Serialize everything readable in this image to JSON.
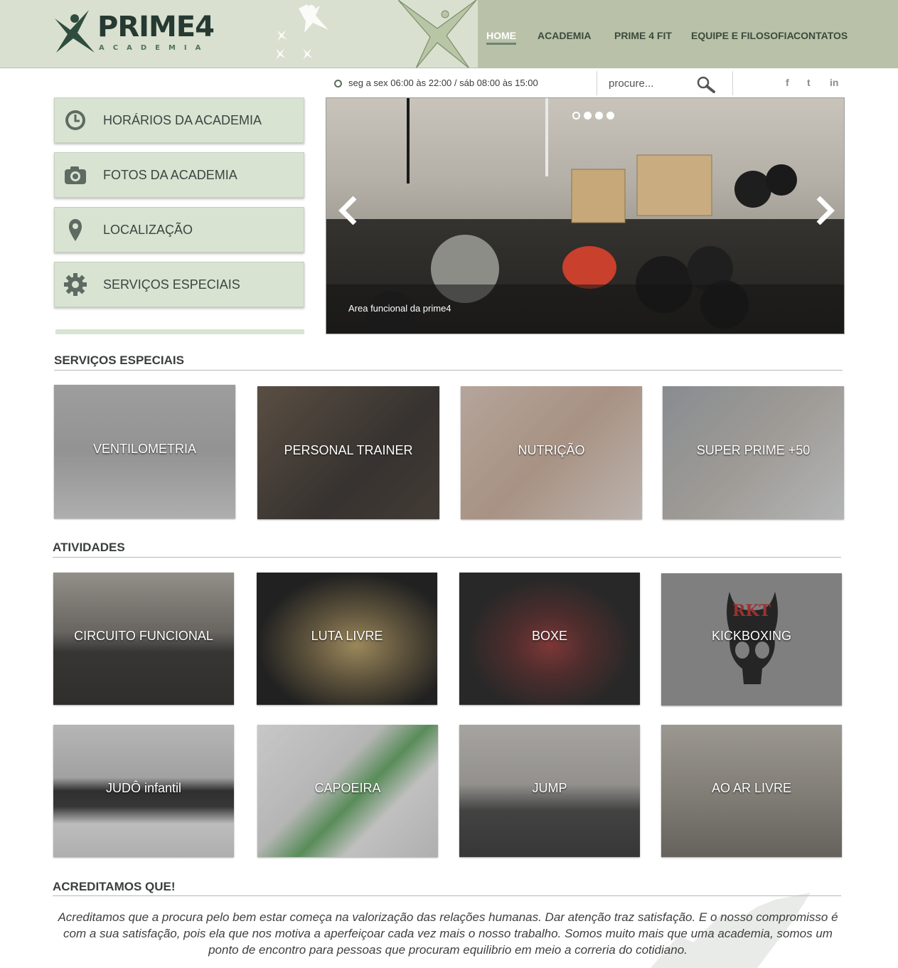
{
  "brand": {
    "name": "PRIME4",
    "subtitle": "ACADEMIA",
    "colors": {
      "header_light": "#d9e0cf",
      "header_dark": "#b9c2a8",
      "logo_text": "#263a33",
      "menu_bg": "#d9e3d2",
      "accent": "#6d8573"
    }
  },
  "nav": {
    "items": [
      {
        "label": "HOME",
        "active": true
      },
      {
        "label": "ACADEMIA"
      },
      {
        "label": "PRIME 4 FIT"
      },
      {
        "label": "EQUIPE E FILOSOFIA"
      },
      {
        "label": "CONTATOS"
      }
    ]
  },
  "infobar": {
    "hours": "seg a sex 06:00 às 22:00 / sáb 08:00 às 15:00",
    "search_placeholder": "procure...",
    "social": [
      {
        "label": "f",
        "icon": "facebook-icon"
      },
      {
        "label": "t",
        "icon": "twitter-icon"
      },
      {
        "label": "in",
        "icon": "linkedin-icon"
      }
    ]
  },
  "menu": {
    "items": [
      {
        "label": "HORÁRIOS DA ACADEMIA",
        "icon": "clock-icon"
      },
      {
        "label": "FOTOS DA ACADEMIA",
        "icon": "camera-icon"
      },
      {
        "label": "LOCALIZAÇÃO",
        "icon": "map-pin-icon"
      },
      {
        "label": "SERVIÇOS ESPECIAIS",
        "icon": "gear-icon"
      }
    ]
  },
  "slider": {
    "caption": "Area funcional da prime4",
    "slide_count": 4,
    "active_slide": 1
  },
  "services": {
    "title": "SERVIÇOS ESPECIAIS",
    "items": [
      {
        "label": "VENTILOMETRIA"
      },
      {
        "label": "PERSONAL TRAINER"
      },
      {
        "label": "NUTRIÇÃO"
      },
      {
        "label": "SUPER PRIME +50"
      }
    ]
  },
  "activities": {
    "title": "ATIVIDADES",
    "items": [
      {
        "label": "CIRCUITO FUNCIONAL"
      },
      {
        "label": "LUTA LIVRE"
      },
      {
        "label": "BOXE"
      },
      {
        "label": "KICKBOXING"
      },
      {
        "label": "JUDÔ infantil"
      },
      {
        "label": "CAPOEIRA"
      },
      {
        "label": "JUMP"
      },
      {
        "label": "AO AR LIVRE"
      }
    ],
    "kickboxing_logo_text": "RKT"
  },
  "about": {
    "title": "ACREDITAMOS QUE!",
    "text": "Acreditamos que a procura pelo bem estar começa na valorização das relações humanas. Dar atenção traz satisfação. E o nosso compromisso é com a sua satisfação, pois ela que nos motiva a aperfeiçoar cada vez mais o nosso trabalho. Somos muito mais que uma academia, somos um ponto de encontro para pessoas que procuram equilibrio em meio a correria do cotidiano."
  }
}
